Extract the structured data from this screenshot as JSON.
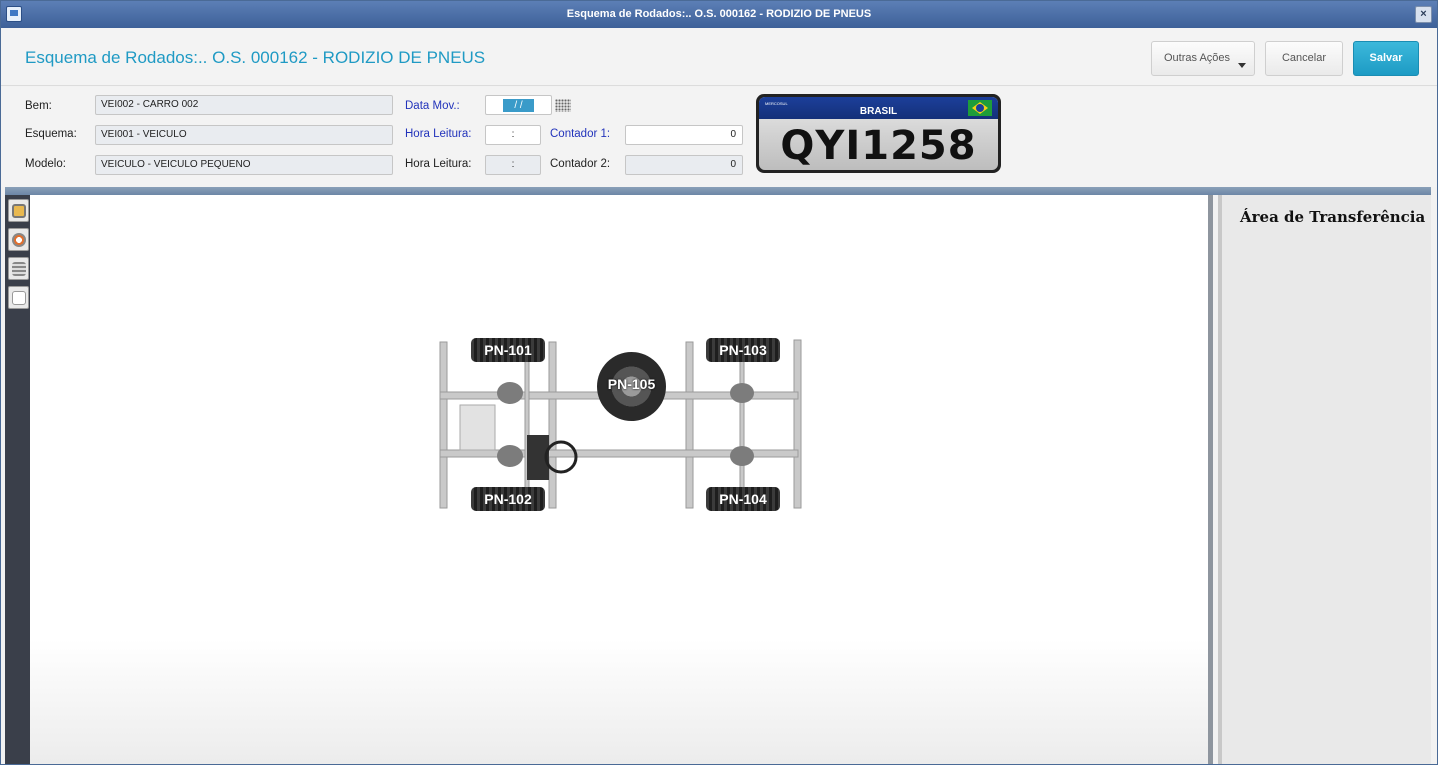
{
  "window": {
    "title": "Esquema de Rodados:.. O.S. 000162 - RODIZIO DE PNEUS",
    "close_label": "×"
  },
  "header": {
    "title": "Esquema de Rodados:.. O.S. 000162 - RODIZIO DE PNEUS",
    "outras_acoes": "Outras Ações",
    "cancelar": "Cancelar",
    "salvar": "Salvar"
  },
  "form": {
    "bem_label": "Bem:",
    "bem_value": "VEI002 - CARRO 002",
    "esquema_label": "Esquema:",
    "esquema_value": "VEI001 - VEICULO",
    "modelo_label": "Modelo:",
    "modelo_value": "VEICULO - VEICULO PEQUENO",
    "data_mov_label": "Data Mov.:",
    "data_mov_value": "/ /",
    "hora_leitura_label_1": "Hora Leitura:",
    "hora_leitura_value_1": ":",
    "hora_leitura_label_2": "Hora Leitura:",
    "hora_leitura_value_2": ":",
    "contador1_label": "Contador 1:",
    "contador1_value": "0",
    "contador2_label": "Contador 2:",
    "contador2_value": "0"
  },
  "plate": {
    "country": "BRASIL",
    "merco": "MERCOSUL",
    "number": "QYI1258"
  },
  "transfer": {
    "title": "Área de Transferência"
  },
  "tires": {
    "pn101": "PN-101",
    "pn102": "PN-102",
    "pn103": "PN-103",
    "pn104": "PN-104",
    "pn105": "PN-105"
  },
  "colors": {
    "accent": "#1f9ac4",
    "label_blue": "#2233bb",
    "save": "#1d9bc4"
  }
}
